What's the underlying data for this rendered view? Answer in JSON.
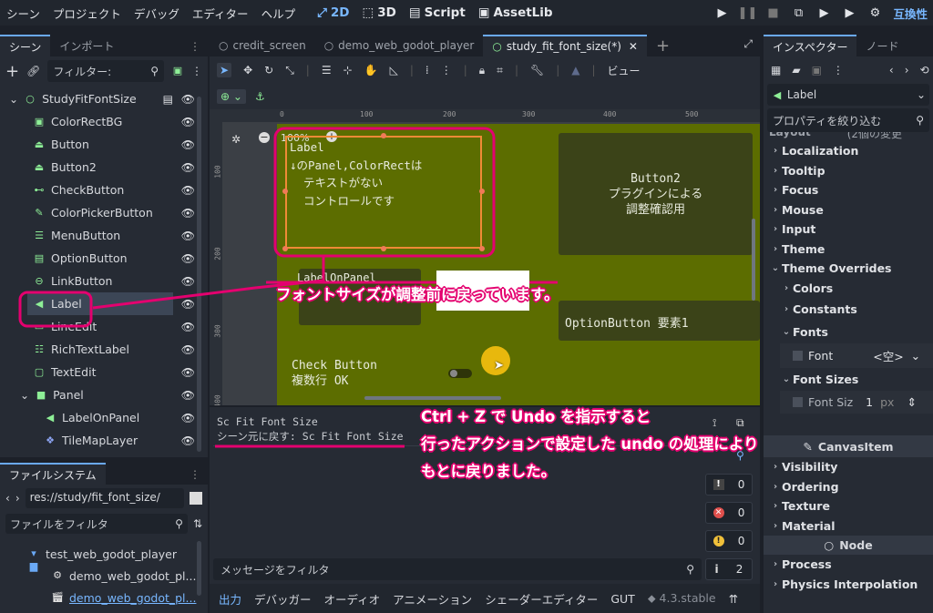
{
  "menubar": {
    "items": [
      "シーン",
      "プロジェクト",
      "デバッグ",
      "エディター",
      "ヘルプ"
    ],
    "workspaces": [
      {
        "label": "2D",
        "icon": "2d-icon"
      },
      {
        "label": "3D",
        "icon": "3d-icon"
      },
      {
        "label": "Script",
        "icon": "script-icon"
      },
      {
        "label": "AssetLib",
        "icon": "assetlib-icon"
      }
    ],
    "compat_label": "互換性"
  },
  "scene_panel": {
    "tabs": [
      "シーン",
      "インポート"
    ],
    "filter_placeholder": "フィルター: ",
    "nodes": [
      {
        "name": "StudyFitFontSize",
        "icon": "node-icon"
      },
      {
        "name": "ColorRectBG",
        "icon": "colorrect-icon"
      },
      {
        "name": "Button",
        "icon": "button-icon"
      },
      {
        "name": "Button2",
        "icon": "button-icon"
      },
      {
        "name": "CheckButton",
        "icon": "checkbutton-icon"
      },
      {
        "name": "ColorPickerButton",
        "icon": "colorpicker-icon"
      },
      {
        "name": "MenuButton",
        "icon": "menubutton-icon"
      },
      {
        "name": "OptionButton",
        "icon": "optionbutton-icon"
      },
      {
        "name": "LinkButton",
        "icon": "linkbutton-icon"
      },
      {
        "name": "Label",
        "icon": "label-icon"
      },
      {
        "name": "LineEdit",
        "icon": "lineedit-icon"
      },
      {
        "name": "RichTextLabel",
        "icon": "richtext-icon"
      },
      {
        "name": "TextEdit",
        "icon": "textedit-icon"
      },
      {
        "name": "Panel",
        "icon": "panel-icon"
      },
      {
        "name": "LabelOnPanel",
        "icon": "label-icon"
      },
      {
        "name": "TileMapLayer",
        "icon": "tilemap-icon"
      }
    ]
  },
  "filesystem": {
    "tab": "ファイルシステム",
    "path": "res://study/fit_font_size/",
    "filter_placeholder": "ファイルをフィルタ",
    "items": [
      "test_web_godot_player",
      "demo_web_godot_pl...",
      "demo_web_godot_pl..."
    ]
  },
  "editor_tabs": [
    "credit_screen",
    "demo_web_godot_player",
    "study_fit_font_size(*)"
  ],
  "toolbar": {
    "view_label": "ビュー"
  },
  "ruler": {
    "ticks": [
      "0",
      "100",
      "200",
      "300",
      "400",
      "500"
    ],
    "vticks": [
      "100",
      "200",
      "300",
      "400"
    ]
  },
  "viewport": {
    "zoom": "100%",
    "label_text": [
      "Label",
      "↓のPanel,ColorRectは",
      "  テキストがない",
      "  コントロールです"
    ],
    "button2_text": [
      "Button2",
      "プラグインによる",
      "調整確認用"
    ],
    "label_on_panel": "LabelOnPanel",
    "option_button": "OptionButton 要素1",
    "check_button": [
      "Check Button",
      "複数行 OK"
    ]
  },
  "output": {
    "lines": [
      "Sc Fit Font Size",
      "シーン元に戻す: Sc Fit Font Size"
    ],
    "filter_placeholder": "メッセージをフィルタ",
    "counts": [
      "0",
      "0",
      "0",
      "2"
    ]
  },
  "bottom_tabs": [
    "出力",
    "デバッガー",
    "オーディオ",
    "アニメーション",
    "シェーダーエディター",
    "GUT"
  ],
  "version": "4.3.stable",
  "inspector": {
    "tabs": [
      "インスペクター",
      "ノード"
    ],
    "node_name": "Label",
    "filter_placeholder": "プロパティを絞り込む",
    "layout_hint": "(2個の変更",
    "sections": [
      "Layout",
      "Localization",
      "Tooltip",
      "Focus",
      "Mouse",
      "Input",
      "Theme",
      "Theme Overrides"
    ],
    "overrides": [
      "Colors",
      "Constants",
      "Fonts"
    ],
    "font_label": "Font",
    "font_value": "<空>",
    "font_sizes": "Font Sizes",
    "font_size_label": "Font Siz",
    "font_size_value": "1",
    "font_size_unit": "px",
    "canvas_item": "CanvasItem",
    "canvas_sections": [
      "Visibility",
      "Ordering",
      "Texture",
      "Material"
    ],
    "node_header": "Node",
    "node_sections": [
      "Process",
      "Physics Interpolation"
    ]
  },
  "annotations": {
    "font_size_note": "フォントサイズが調整前に戻っています。",
    "undo_note": [
      "Ctrl + Z で Undo を指示すると",
      "行ったアクションで設定した undo の処理により",
      "もとに戻りました。"
    ]
  }
}
